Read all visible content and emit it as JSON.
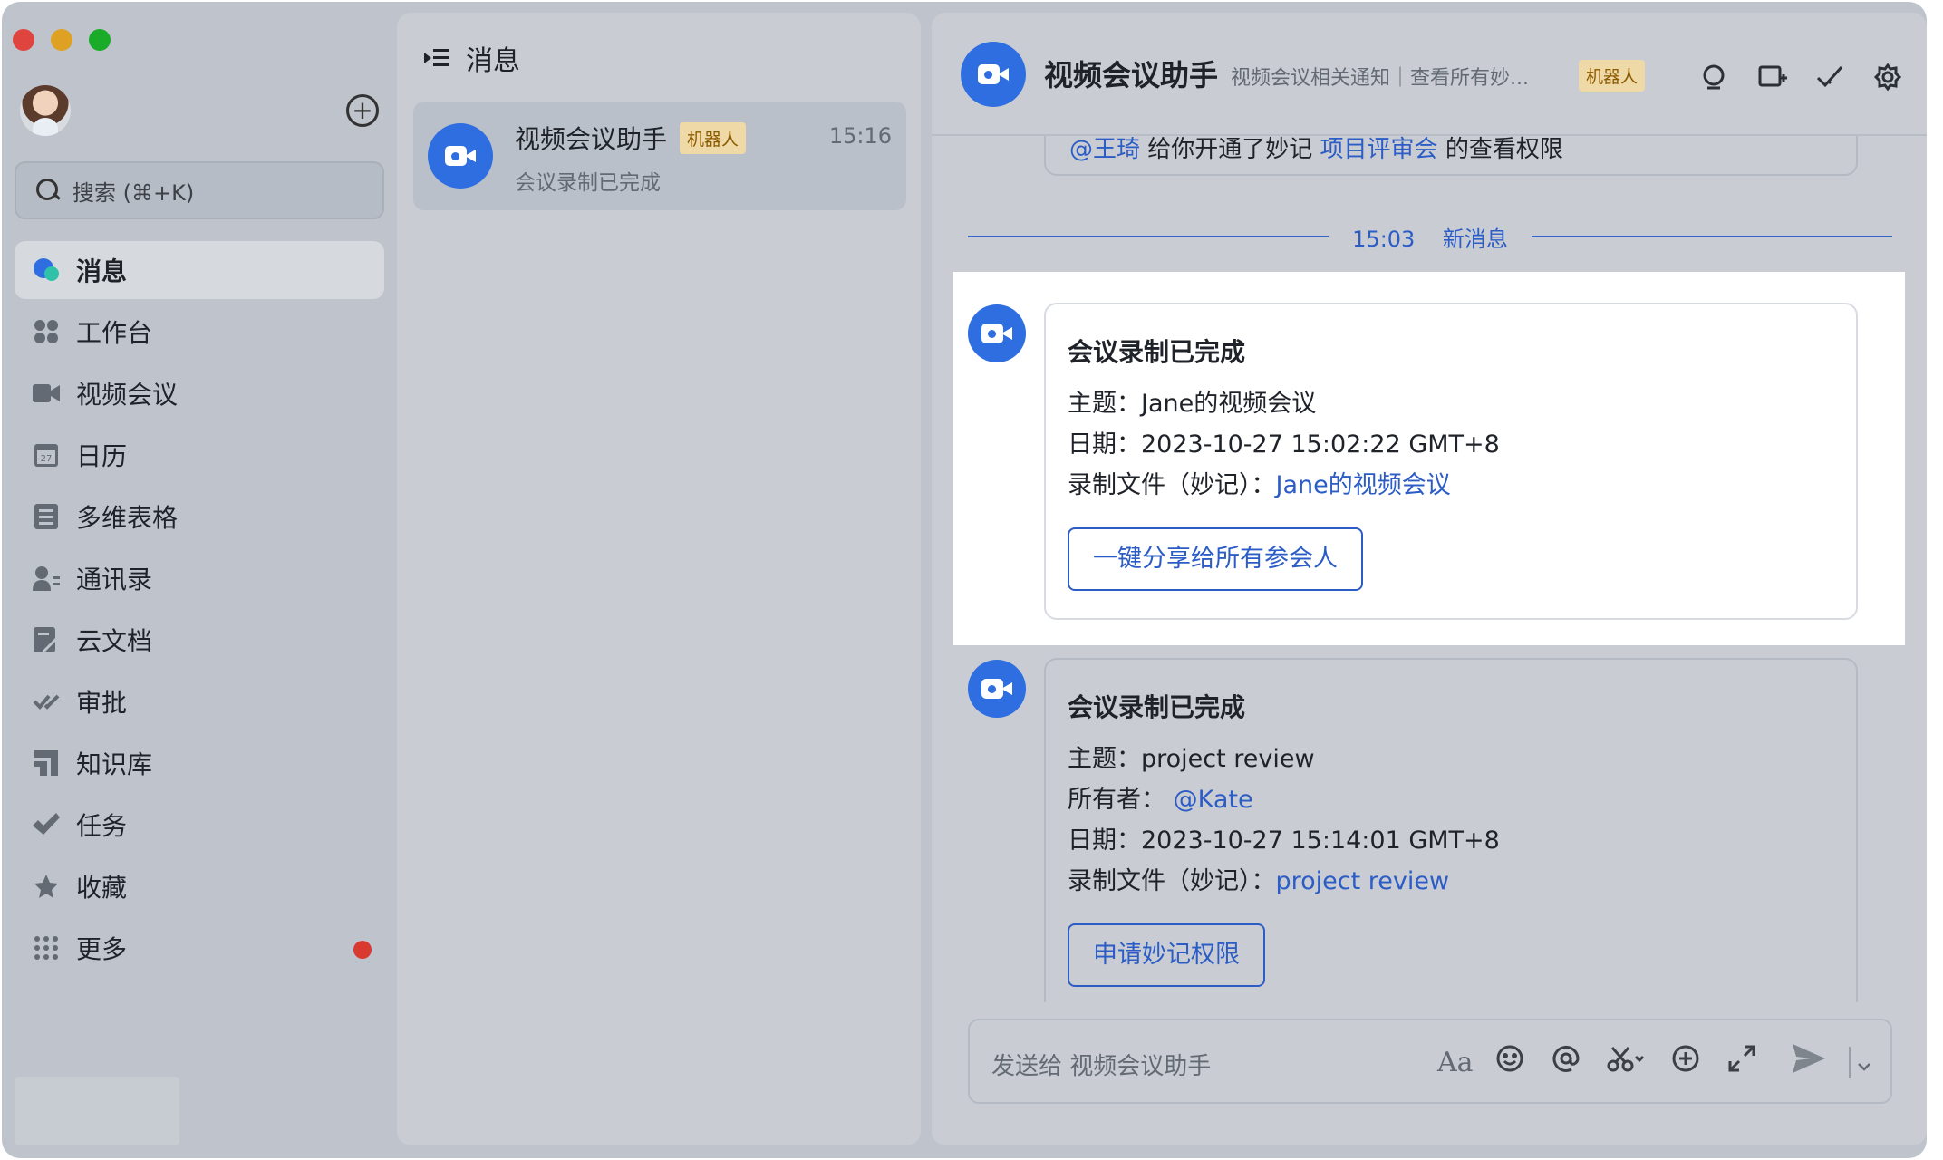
{
  "window": {
    "traffic_colors": [
      "#e0443e",
      "#dea123",
      "#1aab29"
    ]
  },
  "sidebar": {
    "search_placeholder": "搜索 (⌘+K)",
    "items": [
      {
        "label": "消息",
        "icon": "message-icon"
      },
      {
        "label": "工作台",
        "icon": "workspace-icon"
      },
      {
        "label": "视频会议",
        "icon": "video-icon"
      },
      {
        "label": "日历",
        "icon": "calendar-icon",
        "icon_text": "27"
      },
      {
        "label": "多维表格",
        "icon": "table-icon"
      },
      {
        "label": "通讯录",
        "icon": "contacts-icon"
      },
      {
        "label": "云文档",
        "icon": "docs-icon"
      },
      {
        "label": "审批",
        "icon": "approval-icon"
      },
      {
        "label": "知识库",
        "icon": "wiki-icon"
      },
      {
        "label": "任务",
        "icon": "task-icon"
      },
      {
        "label": "收藏",
        "icon": "star-icon"
      },
      {
        "label": "更多",
        "icon": "grid-icon"
      }
    ]
  },
  "list": {
    "title": "消息",
    "chat": {
      "name": "视频会议助手",
      "tag": "机器人",
      "time": "15:16",
      "preview": "会议录制已完成"
    }
  },
  "chat": {
    "header": {
      "title": "视频会议助手",
      "desc": "视频会议相关通知｜查看所有妙...",
      "tag": "机器人"
    },
    "cutoff": {
      "mention": "@王琦",
      "text1": " 给你开通了妙记 ",
      "link": "项目评审会",
      "text2": " 的查看权限"
    },
    "divider": {
      "time": "15:03",
      "label": "新消息"
    },
    "messages": [
      {
        "title": "会议录制已完成",
        "subject_label": "主题：",
        "subject": "Jane的视频会议",
        "date_label": "日期：",
        "date": "2023-10-27 15:02:22 GMT+8",
        "file_label": "录制文件（妙记）：",
        "file_link": "Jane的视频会议",
        "button": "一键分享给所有参会人"
      },
      {
        "title": "会议录制已完成",
        "subject_label": "主题：",
        "subject": "project review",
        "owner_label": "所有者：",
        "owner": "@Kate",
        "date_label": "日期：",
        "date": "2023-10-27 15:14:01 GMT+8",
        "file_label": "录制文件（妙记）：",
        "file_link": "project review",
        "button": "申请妙记权限"
      }
    ],
    "composer": {
      "placeholder": "发送给 视频会议助手"
    }
  },
  "colors": {
    "accent": "#2f6ee0",
    "link": "#2c5cc5",
    "badge": "#d93a2f"
  }
}
